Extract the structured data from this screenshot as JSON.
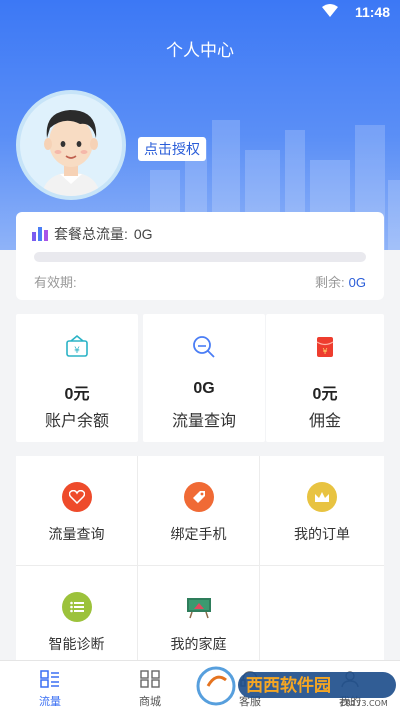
{
  "status_bar": {
    "time": "11:48"
  },
  "header": {
    "title": "个人中心",
    "auth_button": "点击授权"
  },
  "flow_card": {
    "label": "套餐总流量:",
    "value": "0G",
    "progress": 0,
    "validity_label": "有效期:",
    "remaining_label": "剩余:",
    "remaining_value": "0G"
  },
  "stats": [
    {
      "value": "0元",
      "label": "账户余额",
      "icon": "wallet-icon"
    },
    {
      "value": "0G",
      "label": "流量查询",
      "icon": "search-icon"
    },
    {
      "value": "0元",
      "label": "佣金",
      "icon": "red-envelope-icon"
    }
  ],
  "menu": [
    {
      "label": "流量查询",
      "icon": "heart-icon",
      "color": "#ee4b2b"
    },
    {
      "label": "绑定手机",
      "icon": "tag-icon",
      "color": "#f06a35"
    },
    {
      "label": "我的订单",
      "icon": "crown-icon",
      "color": "#e8c341"
    },
    {
      "label": "智能诊断",
      "icon": "list-icon",
      "color": "#9cc23b"
    },
    {
      "label": "我的家庭",
      "icon": "board-icon",
      "color": "#2e7d5b"
    }
  ],
  "tabs": [
    {
      "label": "流量",
      "icon": "flow-icon",
      "active": true
    },
    {
      "label": "商城",
      "icon": "mall-icon",
      "active": false
    },
    {
      "label": "客服",
      "icon": "service-icon",
      "active": false
    },
    {
      "label": "我的",
      "icon": "profile-icon",
      "active": false
    }
  ],
  "watermark": {
    "text": "西西软件园",
    "url_text": "CR173.COM"
  },
  "colors": {
    "accent": "#3a6ff3",
    "header_top": "#3c78f5"
  }
}
